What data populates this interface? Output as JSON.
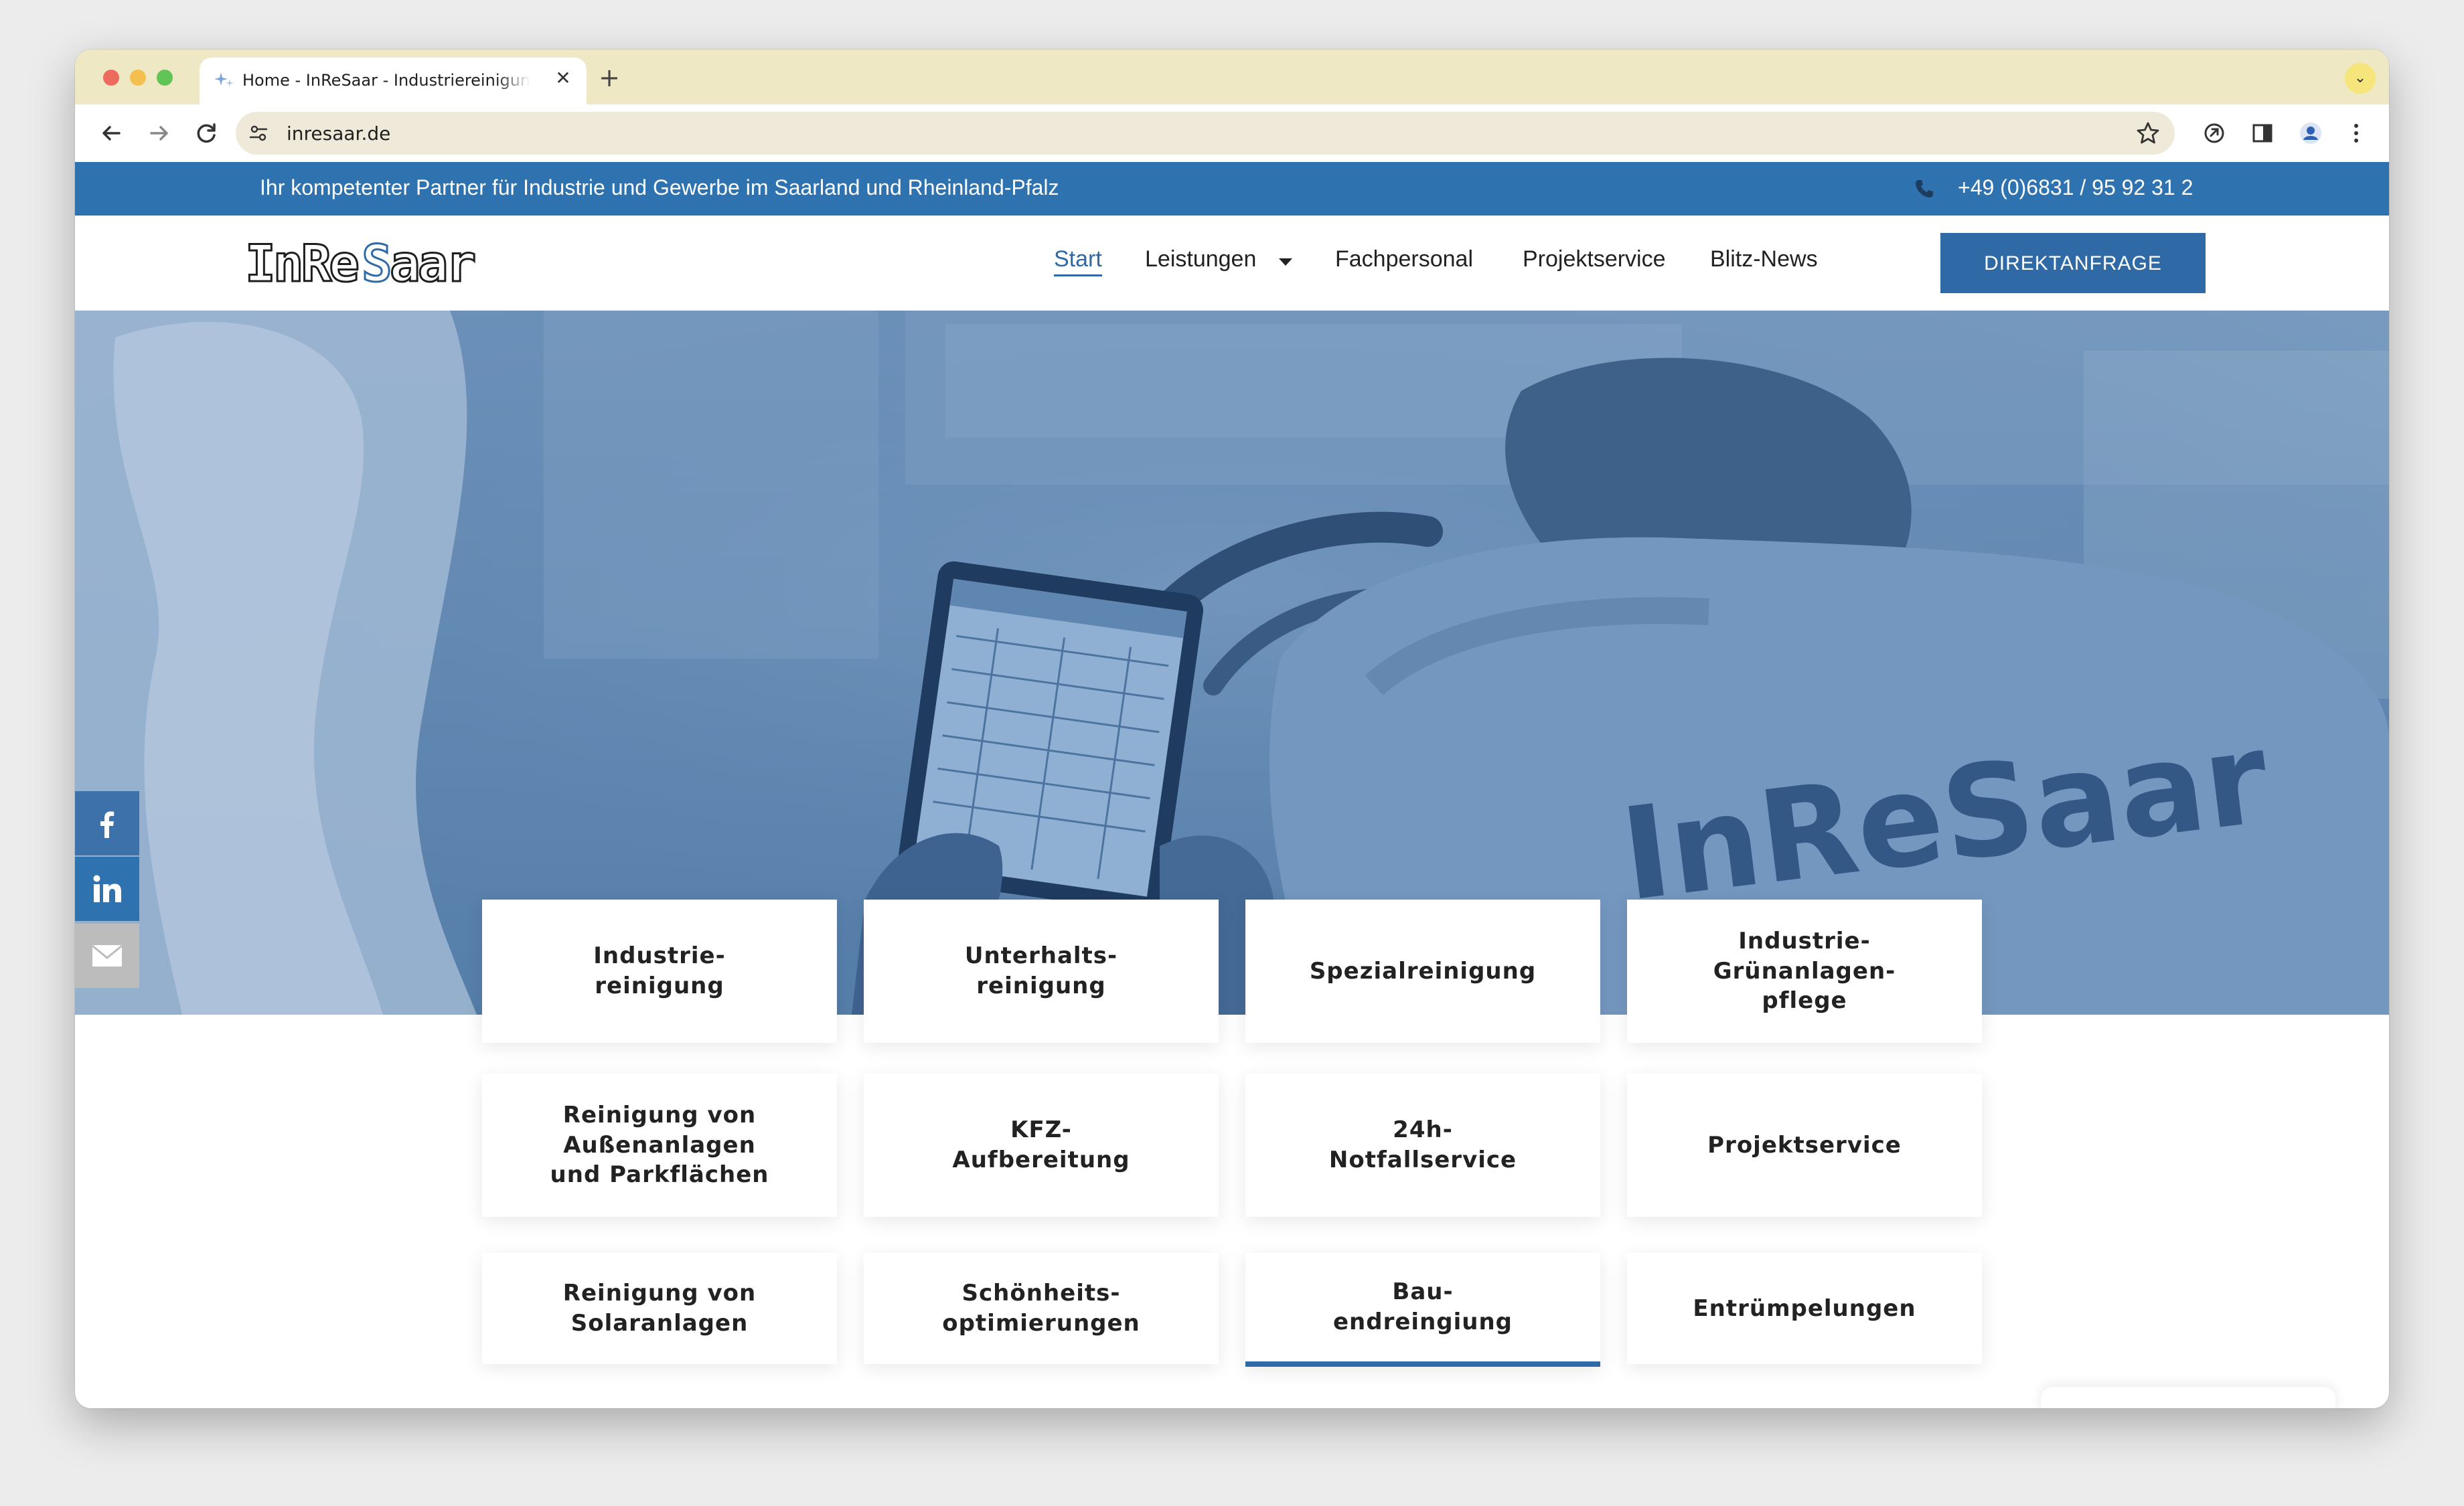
{
  "browser": {
    "tab_title": "Home - InReSaar - Industriereinigung",
    "url": "inresaar.de",
    "close_glyph": "✕",
    "new_tab_glyph": "+",
    "tab_search_glyph": "⌄"
  },
  "site": {
    "topbar": {
      "tagline": "Ihr kompetenter Partner für Industrie und Gewerbe im Saarland und Rheinland-Pfalz",
      "phone": "+49 (0)6831 / 95 92 31 2"
    },
    "logo_text": "InReSaar",
    "nav": {
      "items": [
        {
          "label": "Start"
        },
        {
          "label": "Leistungen"
        },
        {
          "label": "Fachpersonal"
        },
        {
          "label": "Projektservice"
        },
        {
          "label": "Blitz-News"
        }
      ],
      "cta": "DIREKTANFRAGE"
    },
    "hero": {
      "shirt_brand": "InReSaar"
    },
    "services": [
      {
        "label": "Industrie-\nreinigung"
      },
      {
        "label": "Unterhalts-\nreinigung"
      },
      {
        "label": "Spezialreinigung"
      },
      {
        "label": "Industrie-\nGrünanlagen-\npflege"
      },
      {
        "label": "Reinigung von\nAußenanlagen\nund Parkflächen"
      },
      {
        "label": "KFZ-\nAufbereitung"
      },
      {
        "label": "24h-\nNotfallservice"
      },
      {
        "label": "Projektservice"
      },
      {
        "label": "Reinigung von\nSolaranlagen"
      },
      {
        "label": "Schönheits-\noptimierungen"
      },
      {
        "label": "Bau-\nendreingiung"
      },
      {
        "label": "Entrümpelungen"
      }
    ]
  },
  "colors": {
    "brand_blue": "#2f72b0",
    "button_blue": "#2f6aa6",
    "tabstrip": "#eee8c4"
  },
  "icons": [
    "facebook-icon",
    "linkedin-icon",
    "mail-icon",
    "phone-icon",
    "back-arrow-icon",
    "forward-arrow-icon",
    "reload-icon",
    "star-icon",
    "extensions-icon",
    "sidepanel-icon",
    "profile-icon",
    "kebab-menu-icon"
  ]
}
